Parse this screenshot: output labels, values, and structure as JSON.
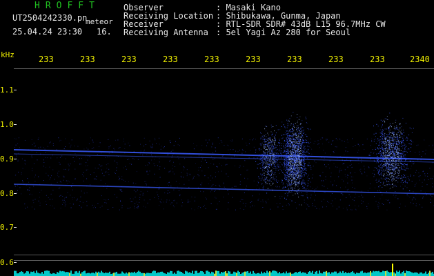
{
  "header": {
    "title": "HROFFT",
    "filename": "UT2504242330.pn",
    "meteor_label": "meteor",
    "datetime": "25.04.24 23:30",
    "count": "16.",
    "info": [
      {
        "label": "Observer",
        "value": ": Masaki Kano"
      },
      {
        "label": "Receiving Location",
        "value": ": Shibukawa, Gunma, Japan"
      },
      {
        "label": "Receiver",
        "value": ": RTL-SDR SDR# 43dB L15 96.7MHz CW"
      },
      {
        "label": "Receiving Antenna",
        "value": ": 5el Yagi Az 280 for Seoul"
      }
    ]
  },
  "axes": {
    "y_unit": "kHz",
    "y_ticks": [
      "1.1",
      "1.0",
      "0.9",
      "0.8",
      "0.7",
      "0.6"
    ],
    "x_ticks": [
      "233",
      "233",
      "233",
      "233",
      "233",
      "233",
      "233",
      "233",
      "233",
      "2340"
    ]
  },
  "colors": {
    "background": "#000000",
    "grid": "#5a5a5a",
    "signal": "#3050ff",
    "meteor": "#b0c8ff",
    "noise_floor": "#00c8c8",
    "spike": "#ffff00",
    "header_title": "#20c020",
    "tick_labels": "#f0f000"
  }
}
